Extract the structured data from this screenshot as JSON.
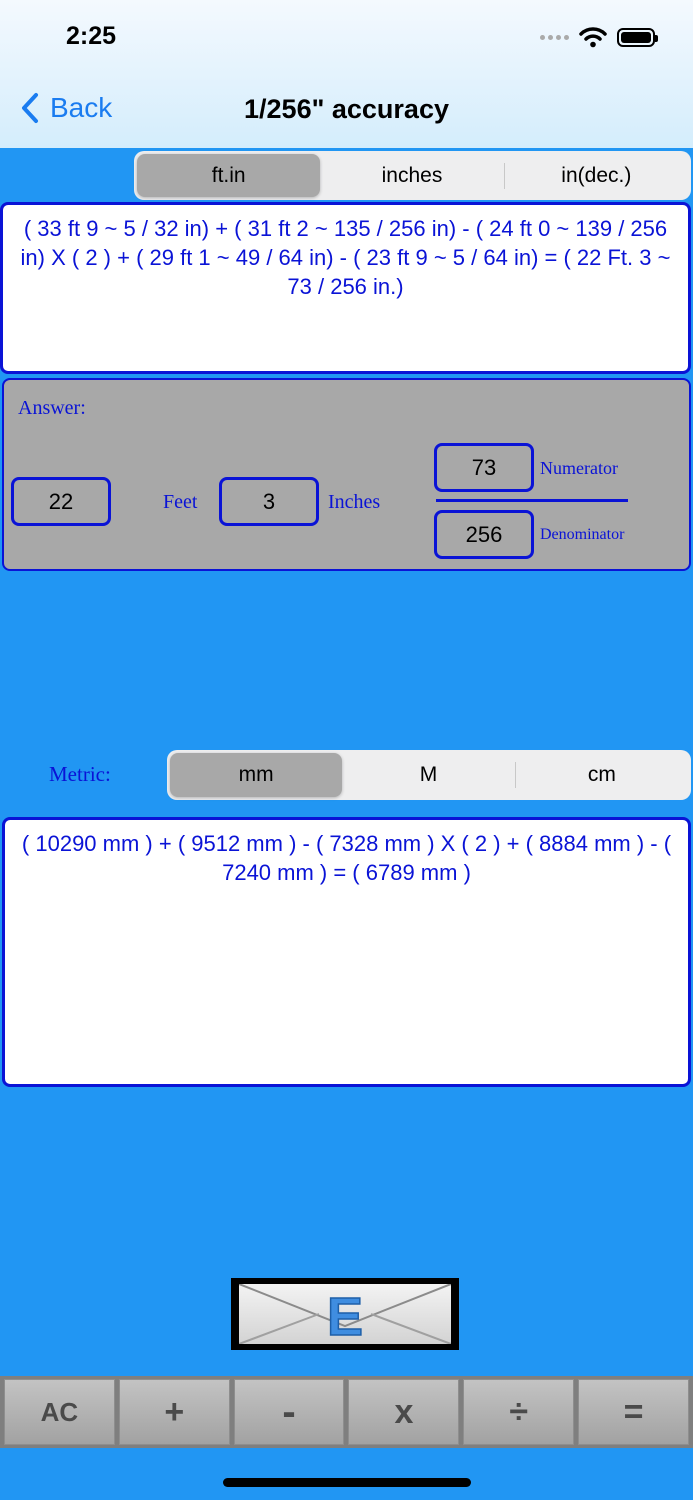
{
  "status": {
    "time": "2:25"
  },
  "nav": {
    "back_label": "Back",
    "title": "1/256\" accuracy"
  },
  "unit_tabs": {
    "options": [
      "ft.in",
      "inches",
      "in(dec.)"
    ],
    "selected": "ft.in"
  },
  "expression_imperial": "( 33 ft 9 ~ 5 / 32 in)  +  ( 31 ft 2 ~ 135 / 256 in)  -  ( 24 ft 0 ~ 139 / 256 in)  X  ( 2 )  +  ( 29 ft 1 ~ 49 / 64 in)  -  ( 23 ft 9 ~ 5 / 64 in)  = ( 22 Ft. 3 ~ 73 / 256 in.)",
  "answer": {
    "label": "Answer:",
    "feet_value": "22",
    "feet_label": "Feet",
    "inches_value": "3",
    "inches_label": "Inches",
    "numerator_value": "73",
    "numerator_label": "Numerator",
    "denominator_value": "256",
    "denominator_label": "Denominator"
  },
  "metric": {
    "label": "Metric:",
    "options": [
      "mm",
      "M",
      "cm"
    ],
    "selected": "mm",
    "expression": "( 10290 mm )  +  ( 9512 mm )  -  ( 7328 mm )  X  ( 2 )  +  ( 8884 mm )  -  ( 7240 mm )  =   ( 6789 mm )"
  },
  "email_button": {
    "letter": "E"
  },
  "keys": [
    "AC",
    "+",
    "-",
    "x",
    "÷",
    "="
  ],
  "colors": {
    "background": "#2196f3",
    "accent": "#0a13d6",
    "panel": "#a8a8a8"
  }
}
